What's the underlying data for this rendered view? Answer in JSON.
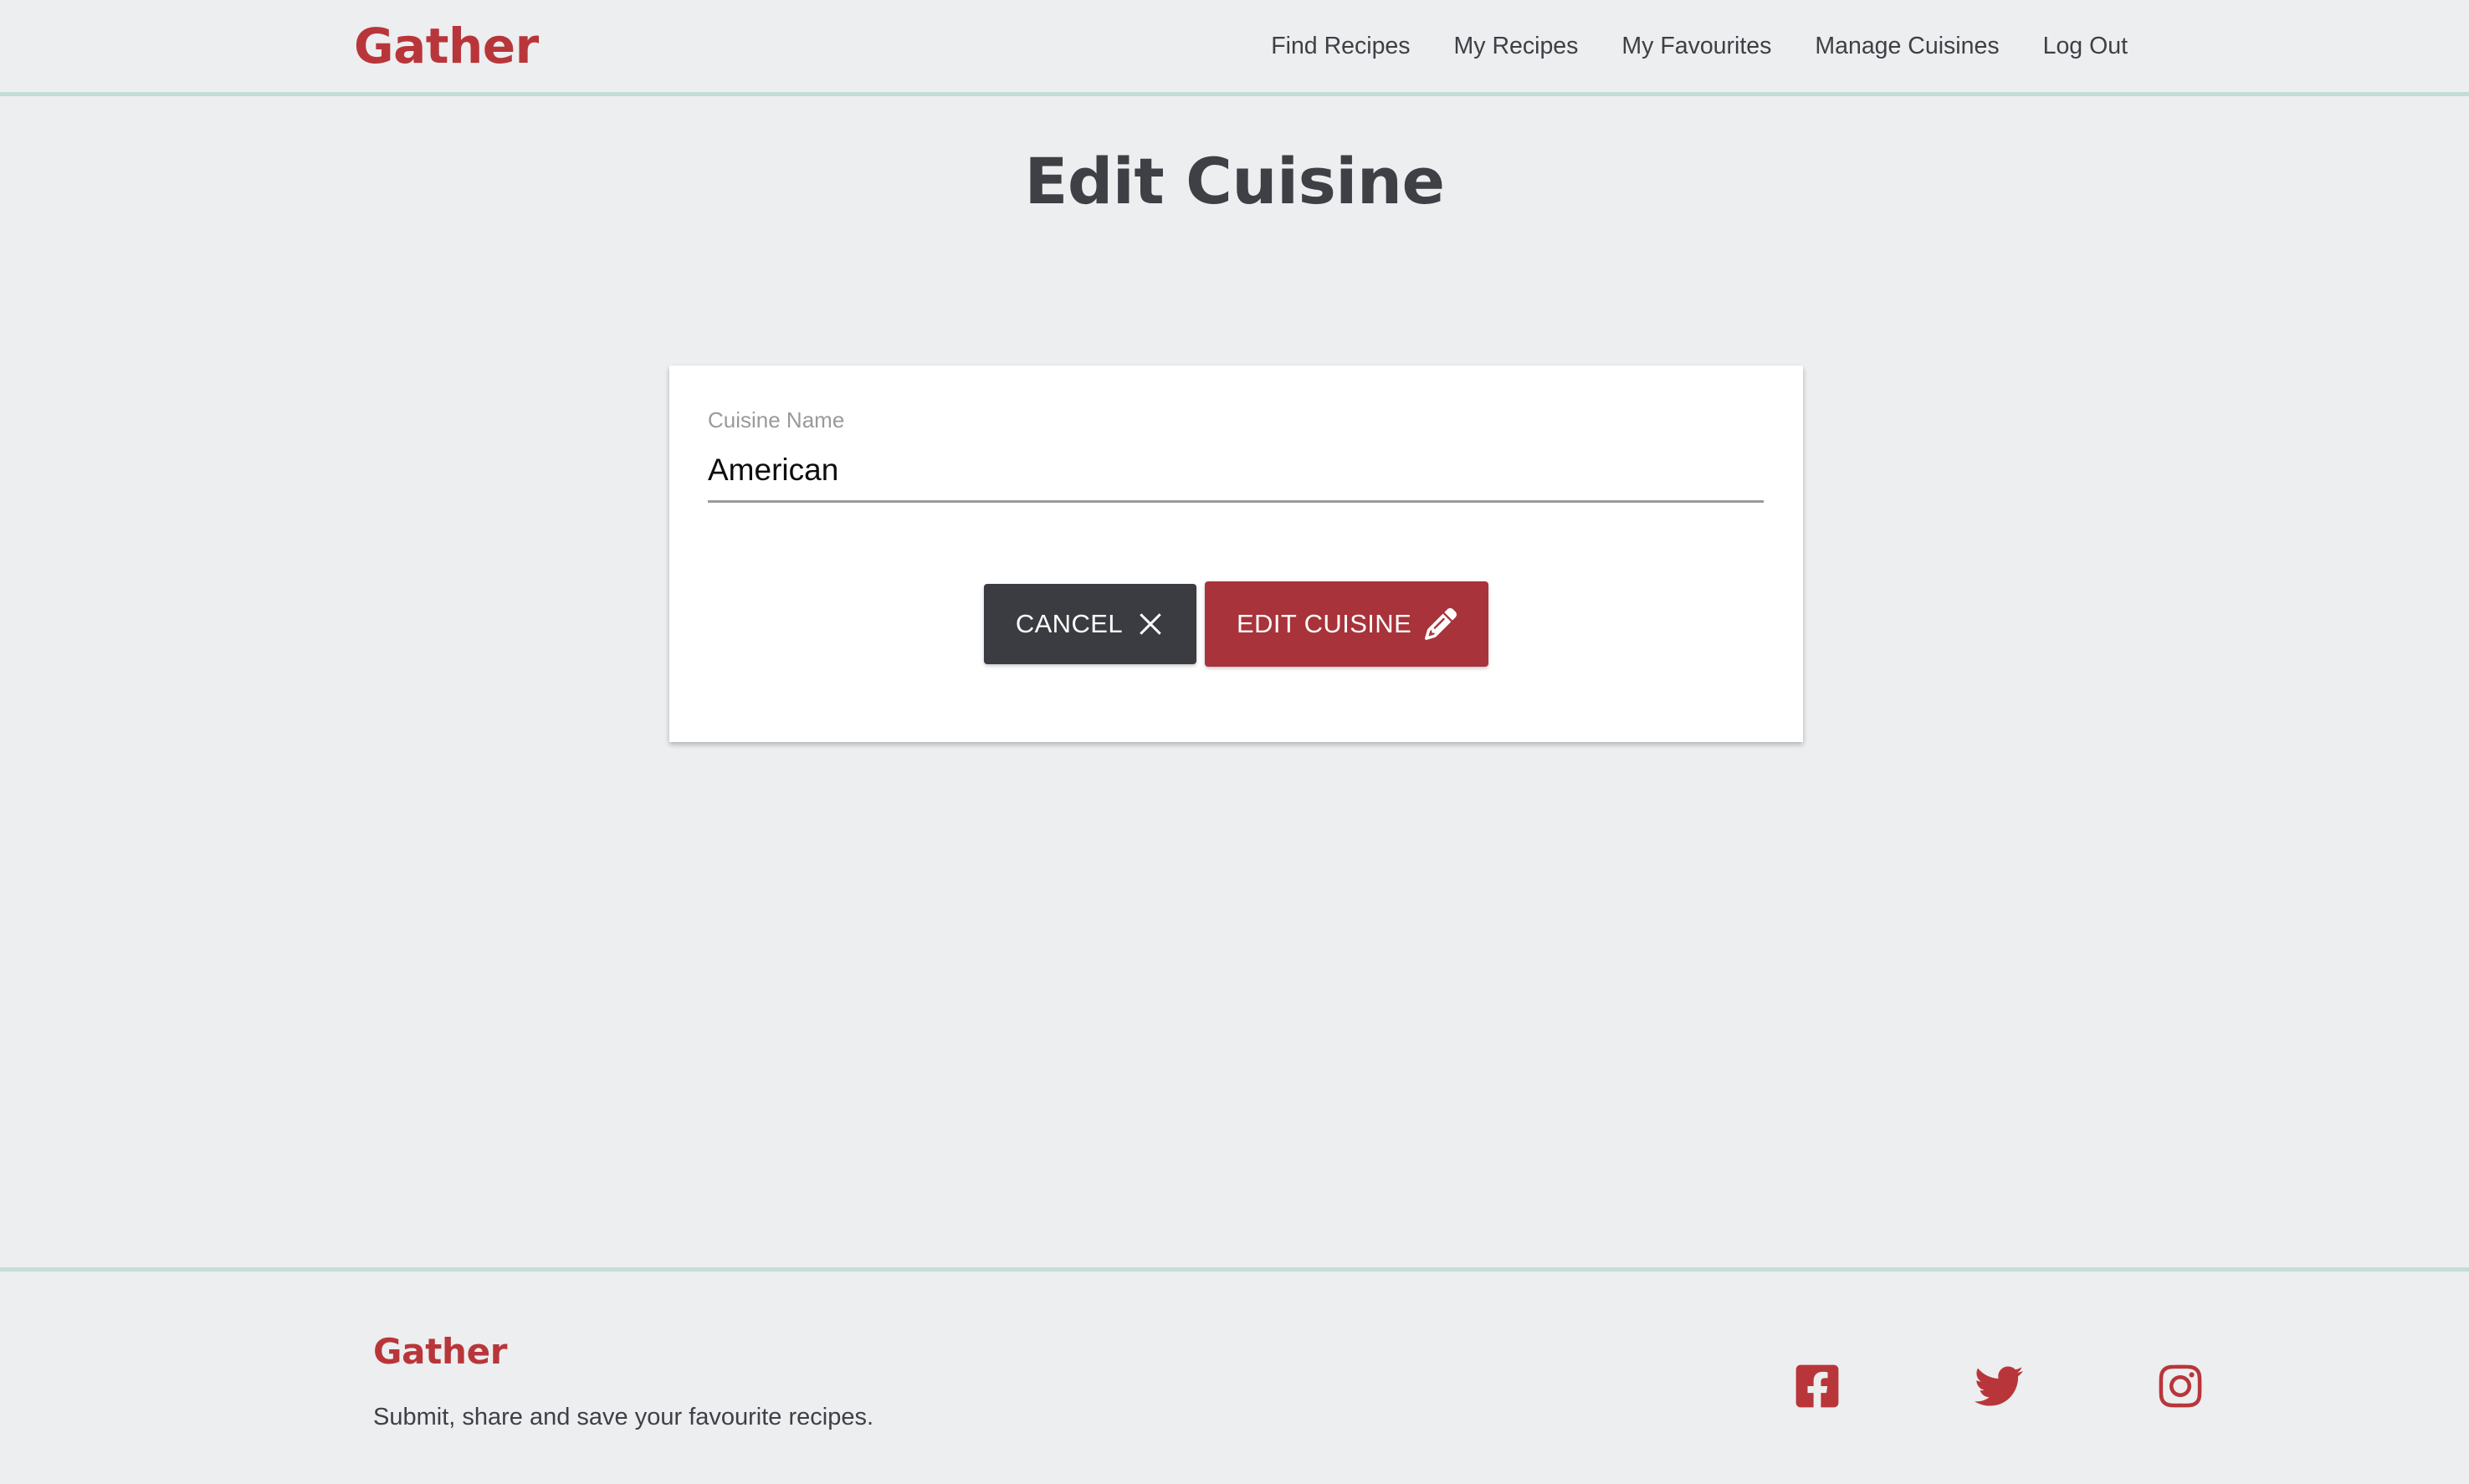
{
  "header": {
    "brand": "Gather",
    "nav": [
      {
        "label": "Find Recipes",
        "name": "nav-find-recipes"
      },
      {
        "label": "My Recipes",
        "name": "nav-my-recipes"
      },
      {
        "label": "My Favourites",
        "name": "nav-my-favourites"
      },
      {
        "label": "Manage Cuisines",
        "name": "nav-manage-cuisines"
      },
      {
        "label": "Log Out",
        "name": "nav-log-out"
      }
    ]
  },
  "main": {
    "title": "Edit Cuisine",
    "form": {
      "cuisine_name_label": "Cuisine Name",
      "cuisine_name_value": "American",
      "cuisine_name_placeholder": "Cuisine Name",
      "cancel_label": "CANCEL",
      "cancel_icon": "close-x-icon",
      "submit_label": "EDIT CUISINE",
      "submit_icon": "pen-to-square-icon"
    }
  },
  "footer": {
    "brand": "Gather",
    "tagline": "Submit, share and save your favourite recipes.",
    "social": [
      {
        "name": "facebook-icon",
        "label": "Facebook"
      },
      {
        "name": "twitter-icon",
        "label": "Twitter"
      },
      {
        "name": "instagram-icon",
        "label": "Instagram"
      }
    ]
  },
  "colors": {
    "background": "#edeef0",
    "brand_red": "#b8363a",
    "button_red": "#a8333a",
    "button_dark": "#3b3c41",
    "rule_mint": "#c2ded6",
    "text_dark": "#3f4046",
    "text_muted": "#9a9a9a",
    "card_white": "#ffffff"
  }
}
